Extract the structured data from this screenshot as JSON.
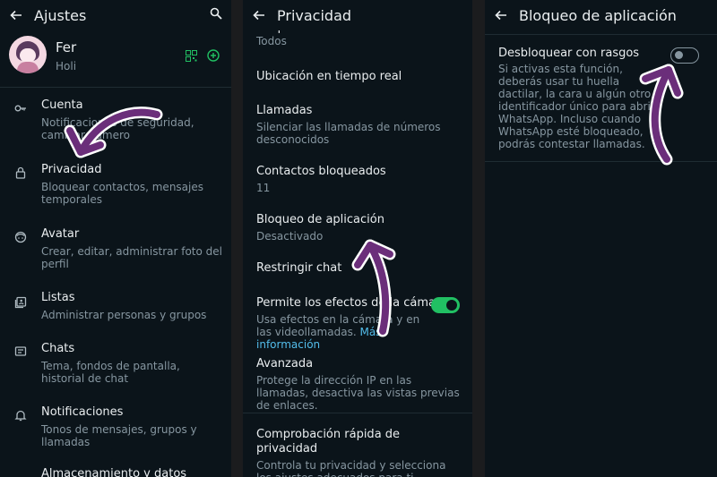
{
  "panel1": {
    "title": "Ajustes",
    "profile": {
      "name": "Fer",
      "status": "Holi"
    },
    "items": [
      {
        "label": "Cuenta",
        "sub": "Notificaciones de seguridad, cambiar número",
        "icon": "key-icon"
      },
      {
        "label": "Privacidad",
        "sub": "Bloquear contactos, mensajes temporales",
        "icon": "lock-icon"
      },
      {
        "label": "Avatar",
        "sub": "Crear, editar, administrar foto del perfil",
        "icon": "avatar-icon"
      },
      {
        "label": "Listas",
        "sub": "Administrar personas y grupos",
        "icon": "lists-icon"
      },
      {
        "label": "Chats",
        "sub": "Tema, fondos de pantalla, historial de chat",
        "icon": "chat-icon"
      },
      {
        "label": "Notificaciones",
        "sub": "Tonos de mensajes, grupos y llamadas",
        "icon": "bell-icon"
      },
      {
        "label": "Almacenamiento y datos",
        "sub": "",
        "icon": "storage-icon"
      }
    ]
  },
  "panel2": {
    "title": "Privacidad",
    "items": [
      {
        "label": "Grupos",
        "sub": "Todos"
      },
      {
        "label": "Ubicación en tiempo real",
        "sub": ""
      },
      {
        "label": "Llamadas",
        "sub": "Silenciar las llamadas de números desconocidos"
      },
      {
        "label": "Contactos bloqueados",
        "sub": "11"
      },
      {
        "label": "Bloqueo de aplicación",
        "sub": "Desactivado"
      },
      {
        "label": "Restringir chat",
        "sub": ""
      },
      {
        "label": "Permite los efectos de la cámara",
        "sub": "Usa efectos en la cámara y en las videollamadas.",
        "link": "Más información"
      },
      {
        "label": "Avanzada",
        "sub": "Protege la dirección IP en las llamadas, desactiva las vistas previas de enlaces."
      },
      {
        "label": "Comprobación rápida de privacidad",
        "sub": "Controla tu privacidad y selecciona los ajustes adecuados para ti."
      }
    ]
  },
  "panel3": {
    "title": "Bloqueo de aplicación",
    "option": {
      "label": "Desbloquear con rasgos",
      "sub": "Si activas esta función, deberás usar tu huella dactilar, la cara u algún otro identificador único para abrir WhatsApp. Incluso cuando WhatsApp esté bloqueado, podrás contestar llamadas."
    }
  },
  "colors": {
    "background": "#0b141a",
    "accent": "#21c063",
    "link": "#53bdeb",
    "arrow": "#6b2e7a"
  }
}
